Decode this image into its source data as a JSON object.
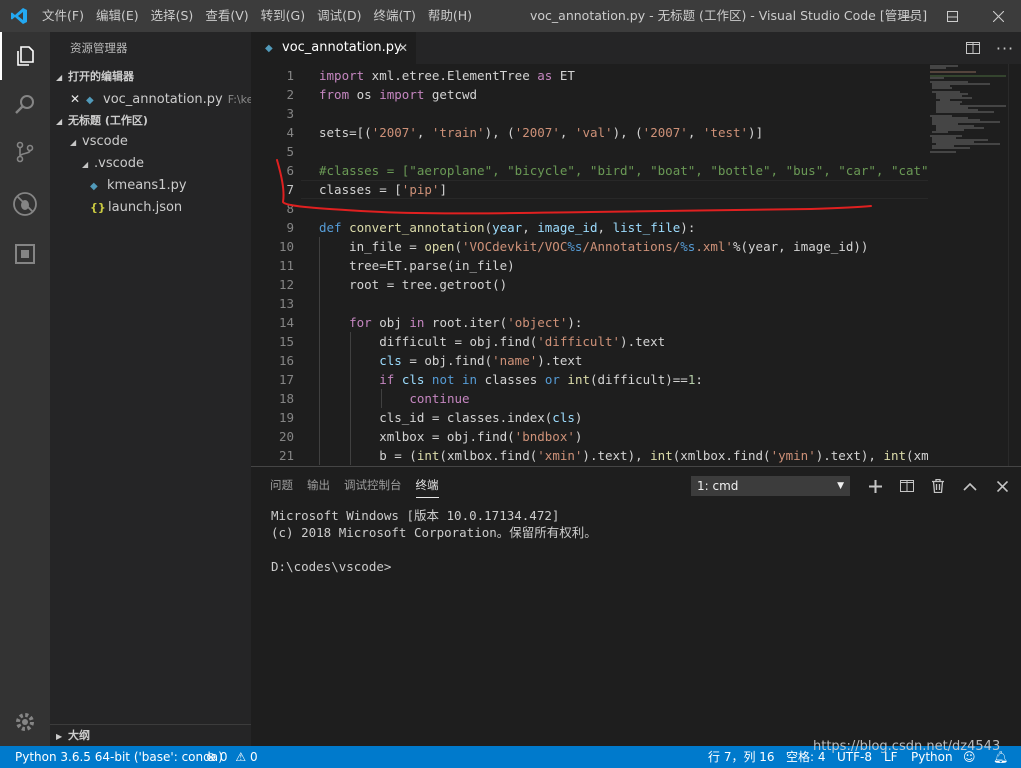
{
  "titlebar": {
    "menu": [
      "文件(F)",
      "编辑(E)",
      "选择(S)",
      "查看(V)",
      "转到(G)",
      "调试(D)",
      "终端(T)",
      "帮助(H)"
    ],
    "window_title": "voc_annotation.py - 无标题 (工作区) - Visual Studio Code [管理员]"
  },
  "sidebar": {
    "title": "资源管理器",
    "open_editors_label": "打开的编辑器",
    "open_editor": {
      "name": "voc_annotation.py",
      "path": "F:\\ke..."
    },
    "workspace_label": "无标题 (工作区)",
    "tree": [
      {
        "label": "vscode",
        "type": "folder"
      },
      {
        "label": ".vscode",
        "type": "folder"
      },
      {
        "label": "kmeans1.py",
        "type": "python"
      },
      {
        "label": "launch.json",
        "type": "json"
      }
    ],
    "outline_label": "大纲"
  },
  "tab": {
    "label": "voc_annotation.py"
  },
  "editor": {
    "line_numbers": [
      "1",
      "2",
      "3",
      "4",
      "5",
      "6",
      "7",
      "8",
      "9",
      "10",
      "11",
      "12",
      "13",
      "14",
      "15",
      "16",
      "17",
      "18",
      "19",
      "20",
      "21"
    ],
    "current_line": "7"
  },
  "panel": {
    "tabs": [
      "问题",
      "输出",
      "调试控制台",
      "终端"
    ],
    "active_tab": "终端",
    "terminal_select": "1: cmd",
    "terminal_lines": [
      "Microsoft Windows [版本 10.0.17134.472]",
      "(c) 2018 Microsoft Corporation。保留所有权利。",
      "",
      "D:\\codes\\vscode>"
    ]
  },
  "statusbar": {
    "interpreter": "Python 3.6.5 64-bit ('base': conda)",
    "errors": "0",
    "warnings": "0",
    "cursor": "行 7，列 16",
    "spaces": "空格: 4",
    "encoding": "UTF-8",
    "eol": "LF",
    "language": "Python"
  },
  "watermark": "https://blog.csdn.net/dz4543",
  "icons": [
    "vscode-logo-icon",
    "files-icon",
    "search-icon",
    "source-control-icon",
    "debug-icon",
    "extensions-icon",
    "settings-gear-icon",
    "split-editor-icon",
    "more-actions-icon",
    "add-terminal-icon",
    "split-terminal-icon",
    "trash-icon",
    "chevron-up-icon",
    "close-icon",
    "bell-icon",
    "smiley-icon"
  ],
  "colors": {
    "accent": "#007acc",
    "annotation": "#e02020"
  }
}
